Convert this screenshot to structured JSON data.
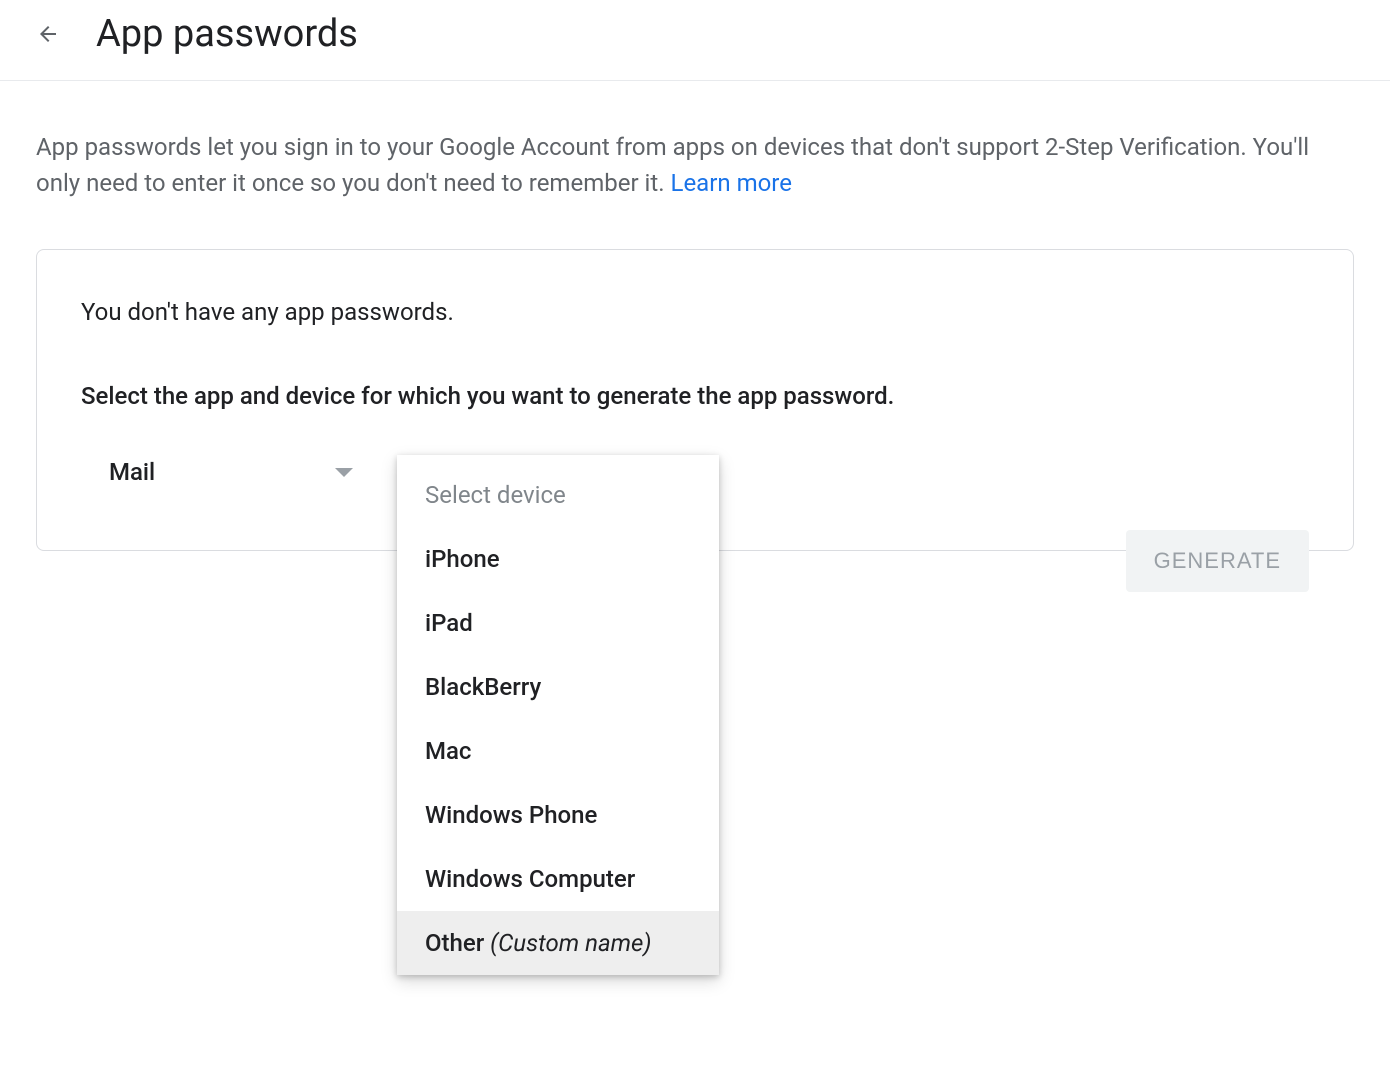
{
  "header": {
    "title": "App passwords"
  },
  "description": {
    "text": "App passwords let you sign in to your Google Account from apps on devices that don't support 2-Step Verification. You'll only need to enter it once so you don't need to remember it. ",
    "learn_more": "Learn more"
  },
  "card": {
    "no_passwords": "You don't have any app passwords.",
    "instruction": "Select the app and device for which you want to generate the app password.",
    "app_select": {
      "selected": "Mail"
    },
    "device_select": {
      "placeholder": "Select device",
      "options": [
        {
          "label": "iPhone"
        },
        {
          "label": "iPad"
        },
        {
          "label": "BlackBerry"
        },
        {
          "label": "Mac"
        },
        {
          "label": "Windows Phone"
        },
        {
          "label": "Windows Computer"
        },
        {
          "label_main": "Other ",
          "label_italic": "(Custom name)",
          "highlighted": true
        }
      ]
    },
    "generate_button": "GENERATE"
  }
}
